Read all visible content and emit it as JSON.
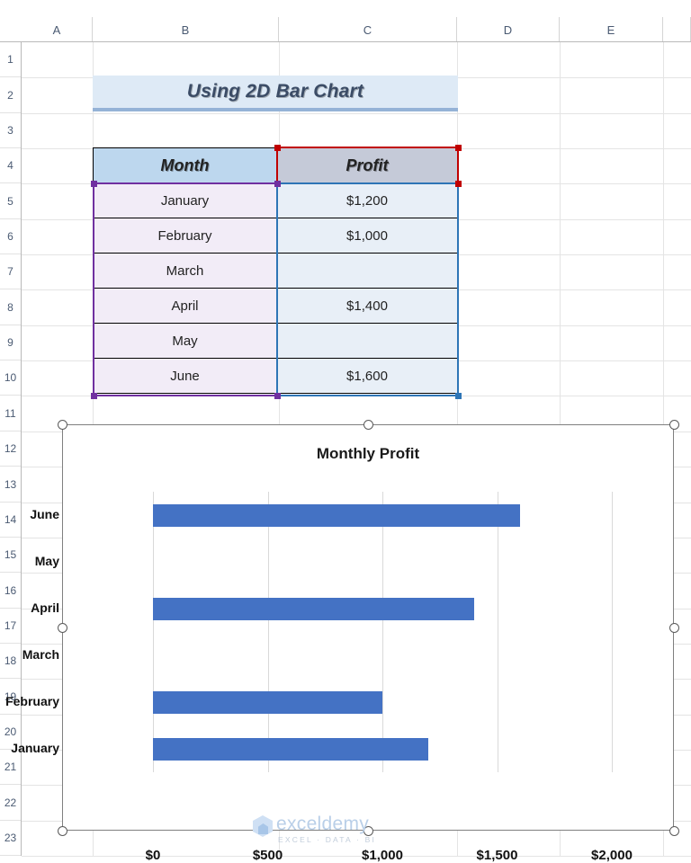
{
  "spreadsheet": {
    "column_headers": [
      "A",
      "B",
      "C",
      "D",
      "E"
    ],
    "row_headers": [
      "1",
      "2",
      "3",
      "4",
      "5",
      "6",
      "7",
      "8",
      "9",
      "10",
      "11",
      "12",
      "13",
      "14",
      "15",
      "16",
      "17",
      "18",
      "19",
      "20",
      "21",
      "22",
      "23"
    ],
    "select_all_icon": "select-all-triangle"
  },
  "banner": {
    "title": "Using 2D Bar Chart"
  },
  "table": {
    "headers": [
      "Month",
      "Profit"
    ],
    "rows": [
      {
        "month": "January",
        "profit": "$1,200"
      },
      {
        "month": "February",
        "profit": "$1,000"
      },
      {
        "month": "March",
        "profit": ""
      },
      {
        "month": "April",
        "profit": "$1,400"
      },
      {
        "month": "May",
        "profit": ""
      },
      {
        "month": "June",
        "profit": "$1,600"
      }
    ]
  },
  "selection": {
    "profit_header_color": "#C00000",
    "month_range_color": "#7030A0",
    "profit_range_color": "#2E75B6"
  },
  "chart_data": {
    "type": "bar",
    "title": "Monthly Profit",
    "xlabel": "",
    "ylabel": "",
    "orientation": "horizontal",
    "categories": [
      "January",
      "February",
      "March",
      "April",
      "May",
      "June"
    ],
    "values": [
      1200,
      1000,
      null,
      1400,
      null,
      1600
    ],
    "display_order_top_to_bottom": [
      "June",
      "May",
      "April",
      "March",
      "February",
      "January"
    ],
    "xticks": [
      0,
      500,
      1000,
      1500,
      2000
    ],
    "xticklabels": [
      "$0",
      "$500",
      "$1,000",
      "$1,500",
      "$2,000"
    ],
    "xlim": [
      0,
      2000
    ],
    "grid": "vertical",
    "legend": "none",
    "series_color": "#4472C4"
  },
  "watermark": {
    "name": "exceldemy",
    "tagline": "EXCEL · DATA · BI"
  }
}
